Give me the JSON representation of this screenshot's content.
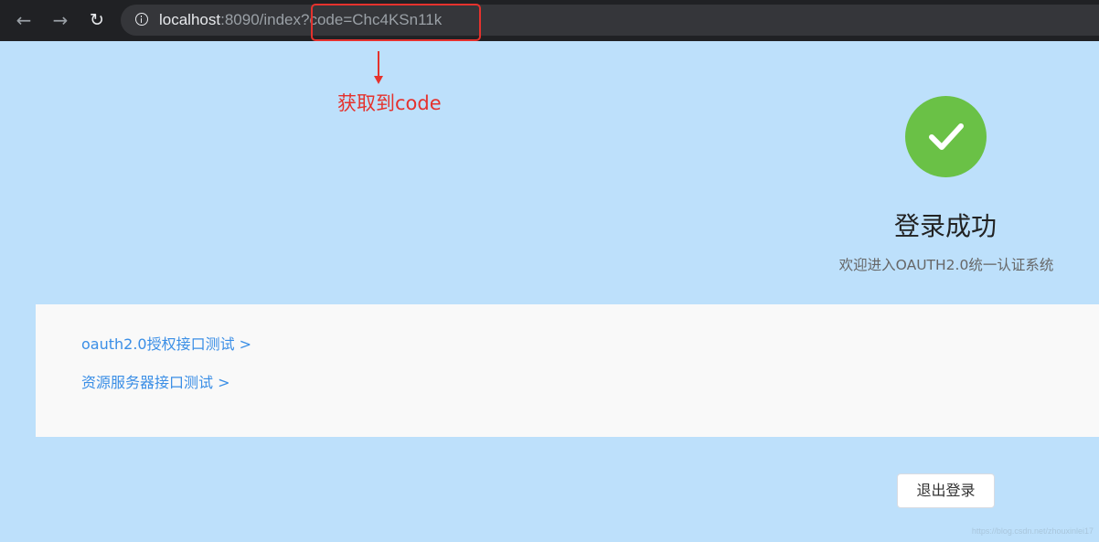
{
  "browser": {
    "back_icon": "arrow-left-icon",
    "forward_icon": "arrow-right-icon",
    "reload_icon": "reload-icon",
    "info_icon": "info-icon",
    "url_host": "localhost",
    "url_rest": ":8090/index",
    "url_query": "?code=Chc4KSn11k"
  },
  "annotation": {
    "text": "获取到code",
    "color": "#e5322d"
  },
  "success": {
    "icon": "check-circle-icon",
    "icon_color": "#6ac146",
    "title": "登录成功",
    "subtitle": "欢迎进入OAUTH2.0统一认证系统"
  },
  "links": [
    {
      "label": "oauth2.0授权接口测试 >"
    },
    {
      "label": "资源服务器接口测试 >"
    }
  ],
  "logout_label": "退出登录",
  "watermark": "https://blog.csdn.net/zhouxinlei17",
  "colors": {
    "page_background": "#bde0fb",
    "link": "#3a8ee6",
    "browser_bar": "#202124"
  }
}
